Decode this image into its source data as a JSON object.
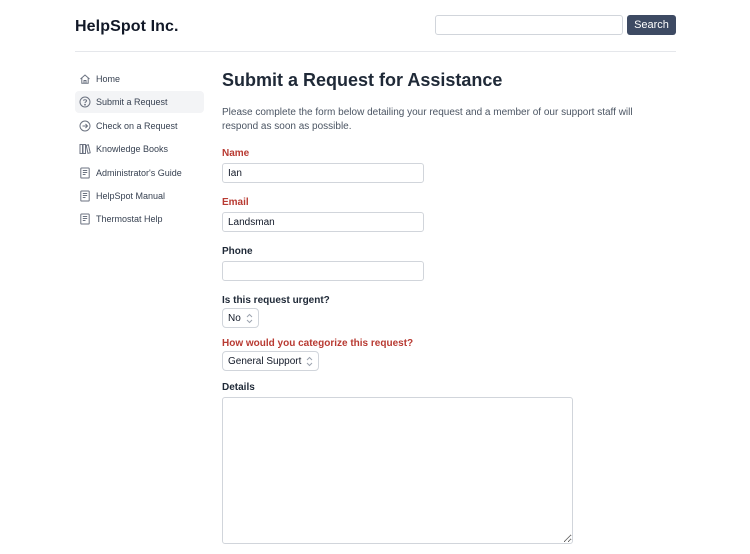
{
  "header": {
    "brand": "HelpSpot Inc.",
    "search_value": "",
    "search_placeholder": "",
    "search_button": "Search"
  },
  "sidebar": {
    "items": [
      {
        "label": "Home",
        "icon": "home-icon",
        "active": false
      },
      {
        "label": "Submit a Request",
        "icon": "question-circle-icon",
        "active": true
      },
      {
        "label": "Check on a Request",
        "icon": "arrow-circle-right-icon",
        "active": false
      },
      {
        "label": "Knowledge Books",
        "icon": "books-icon",
        "active": false
      },
      {
        "label": "Administrator's Guide",
        "icon": "document-icon",
        "active": false
      },
      {
        "label": "HelpSpot Manual",
        "icon": "document-icon",
        "active": false
      },
      {
        "label": "Thermostat Help",
        "icon": "document-icon",
        "active": false
      }
    ]
  },
  "main": {
    "title": "Submit a Request for Assistance",
    "intro": "Please complete the form below detailing your request and a member of our support staff will respond as soon as possible.",
    "form": {
      "name": {
        "label": "Name",
        "value": "Ian",
        "required": true
      },
      "email": {
        "label": "Email",
        "value": "Landsman",
        "required": true
      },
      "phone": {
        "label": "Phone",
        "value": "",
        "required": false
      },
      "urgent": {
        "label": "Is this request urgent?",
        "value": "No"
      },
      "category": {
        "label": "How would you categorize this request?",
        "value": "General Support",
        "required": true
      },
      "details": {
        "label": "Details",
        "value": ""
      }
    }
  },
  "colors": {
    "accent_button": "#3d4a63",
    "required_label": "#b83a32",
    "active_nav_bg": "#f3f4f6"
  }
}
